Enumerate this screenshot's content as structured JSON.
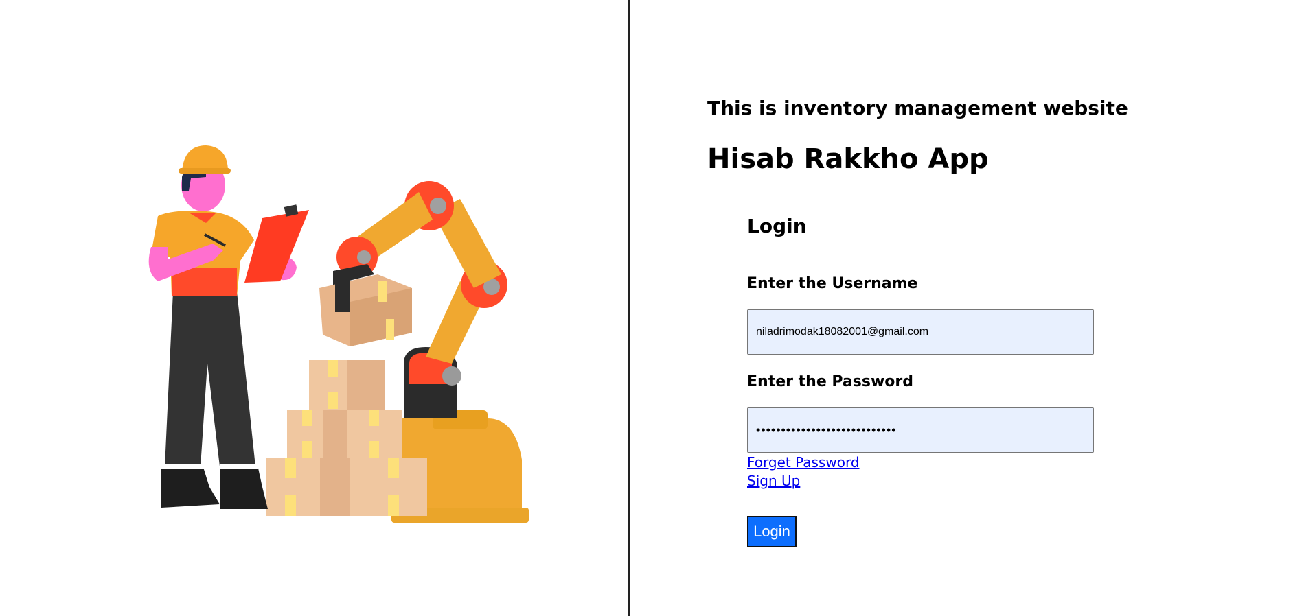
{
  "header": {
    "tagline": "This is inventory management website",
    "app_title": "Hisab Rakkho App"
  },
  "login_form": {
    "heading": "Login",
    "username_label": "Enter the Username",
    "username_value": "niladrimodak18082001@gmail.com",
    "password_label": "Enter the Password",
    "password_masked": "••••••••••••••••••••••••••••",
    "forget_password_link": "Forget Password",
    "sign_up_link": "Sign Up",
    "submit_label": "Login"
  },
  "illustration": {
    "icon": "warehouse-worker-robot-arm-illustration"
  },
  "colors": {
    "input_background": "#e8f0fe",
    "button_background": "#0d6efd",
    "link": "#0000ee",
    "divider": "#222222"
  }
}
